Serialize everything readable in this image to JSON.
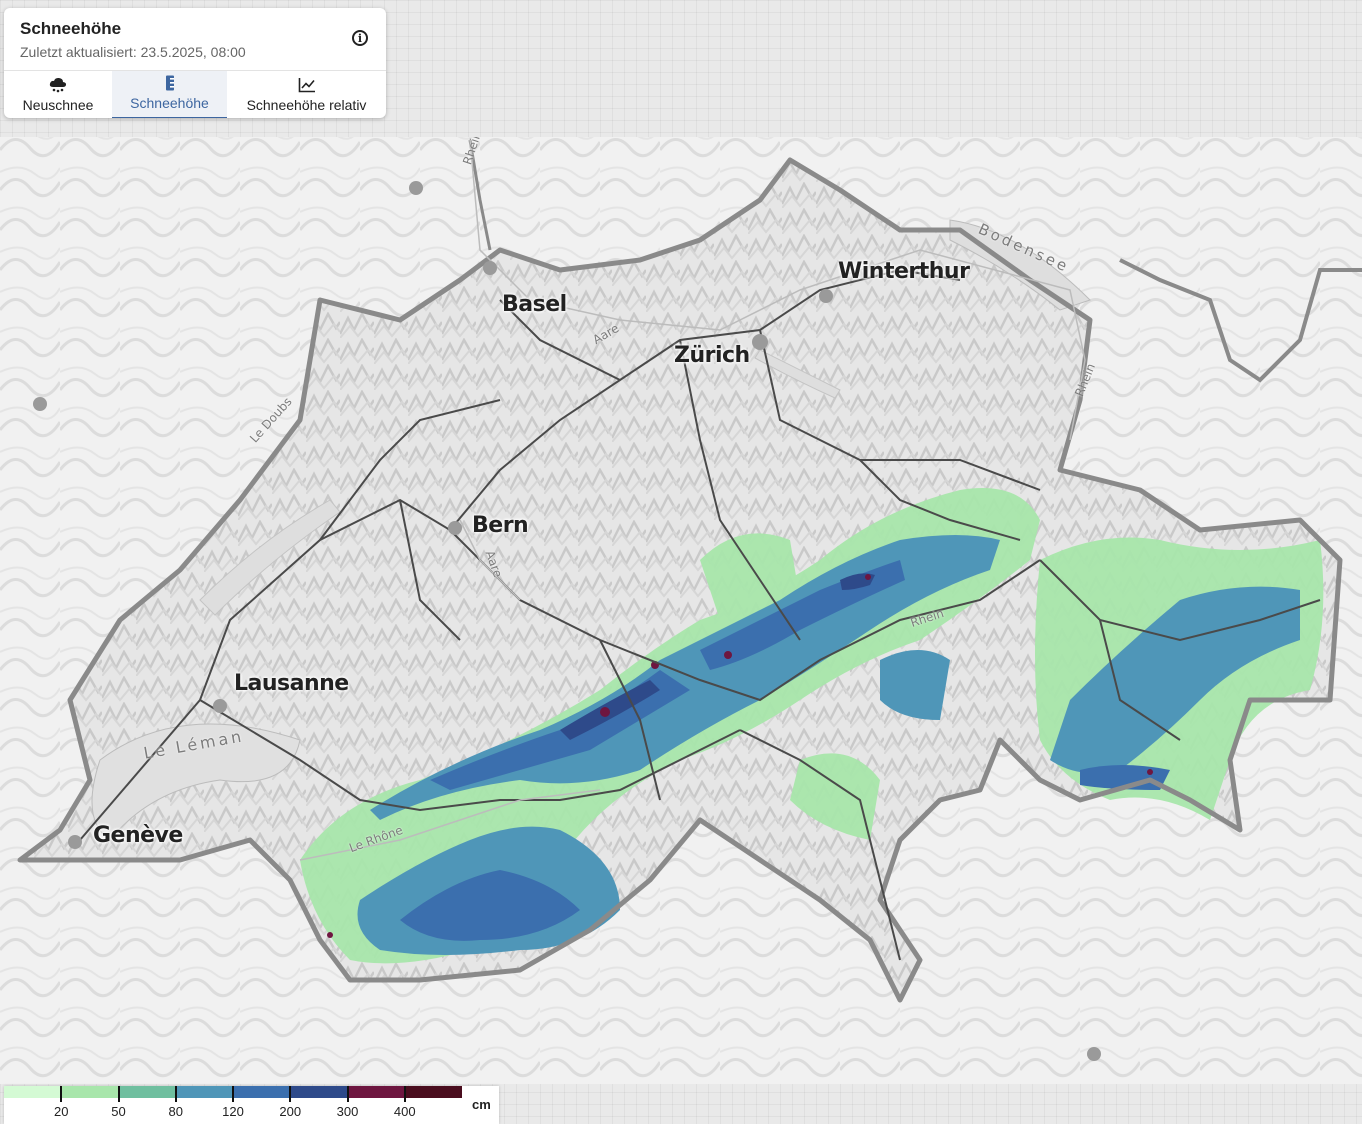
{
  "panel": {
    "title": "Schneehöhe",
    "updated": "Zuletzt aktualisiert: 23.5.2025, 08:00",
    "info_icon": "info-icon",
    "tabs": [
      {
        "label": "Neuschnee",
        "icon": "snow-cloud-icon",
        "active": false
      },
      {
        "label": "Schneehöhe",
        "icon": "snow-depth-ruler-icon",
        "active": true
      },
      {
        "label": "Schneehöhe relativ",
        "icon": "line-chart-icon",
        "active": false
      }
    ]
  },
  "map": {
    "cities": [
      "Basel",
      "Winterthur",
      "Zürich",
      "Bern",
      "Lausanne",
      "Genève"
    ],
    "water_labels": [
      "Bodensee",
      "Le Léman",
      "Le Rhône",
      "Le Doubs",
      "Aare",
      "Aare",
      "Rhein",
      "Rhein",
      "Rhein"
    ]
  },
  "legend": {
    "colors": [
      "#d4fad4",
      "#a8e6ab",
      "#6fbf9f",
      "#4f96b8",
      "#3b6fae",
      "#2e4a8a",
      "#6e1640",
      "#4a0d1e"
    ],
    "ticks": [
      "20",
      "50",
      "80",
      "120",
      "200",
      "300",
      "400"
    ],
    "unit": "cm"
  }
}
